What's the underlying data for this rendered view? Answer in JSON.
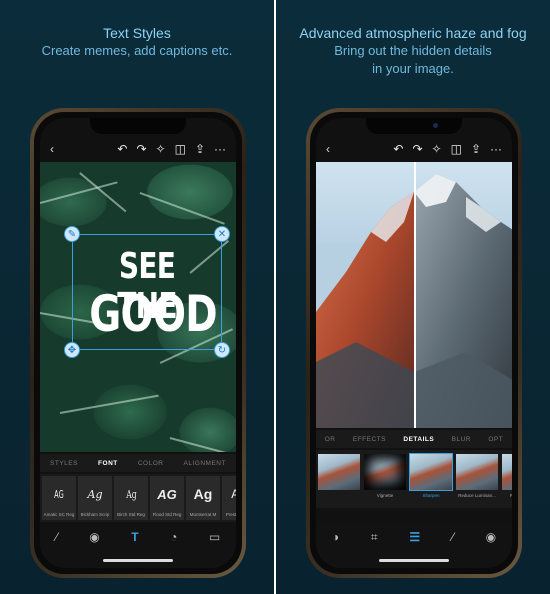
{
  "panels": [
    {
      "caption_title": "Text Styles",
      "caption_lines": [
        "Create memes, add captions etc."
      ]
    },
    {
      "caption_title": "Advanced atmospheric haze and fog",
      "caption_lines": [
        "Bring out the hidden details",
        "in your image."
      ]
    }
  ],
  "left_phone": {
    "topbar": {
      "back": "‹",
      "undo": "↶",
      "redo": "↷",
      "magic": "✧",
      "compare": "◫",
      "share": "⇪",
      "more": "···"
    },
    "overlay_text": [
      "SEE THE",
      "GOOD"
    ],
    "handles": {
      "tl": "✎",
      "tr": "✕",
      "bl": "✥",
      "br": "↻"
    },
    "tabs": [
      {
        "label": "STYLES",
        "active": false
      },
      {
        "label": "FONT",
        "active": true
      },
      {
        "label": "COLOR",
        "active": false
      },
      {
        "label": "ALIGNMENT",
        "active": false
      }
    ],
    "fonts": [
      {
        "glyph": "AG",
        "label": "Amatic SC Reg"
      },
      {
        "glyph": "Ag",
        "label": "Bickham Scrip"
      },
      {
        "glyph": "Ag",
        "label": "Birch Std Reg"
      },
      {
        "glyph": "AG",
        "label": "Flood Std Reg"
      },
      {
        "glyph": "Ag",
        "label": "Montserrat M"
      },
      {
        "glyph": "Ag",
        "label": "Prestige Elite"
      }
    ],
    "bottom_icons": [
      "bandage",
      "eye",
      "T",
      "sticker",
      "frame"
    ]
  },
  "right_phone": {
    "topbar": {
      "back": "‹",
      "undo": "↶",
      "redo": "↷",
      "magic": "✧",
      "compare": "◫",
      "share": "⇪",
      "more": "···"
    },
    "tabs": [
      {
        "label": "OR",
        "active": false
      },
      {
        "label": "EFFECTS",
        "active": false
      },
      {
        "label": "DETAILS",
        "active": true
      },
      {
        "label": "BLUR",
        "active": false
      },
      {
        "label": "OPT",
        "active": false
      }
    ],
    "effects": [
      {
        "label": "",
        "selected": false
      },
      {
        "label": "Vignette",
        "selected": false
      },
      {
        "label": "Sharpen",
        "selected": true
      },
      {
        "label": "Reduce Luminan...",
        "selected": false
      },
      {
        "label": "Reduce Colo",
        "selected": false
      }
    ],
    "bottom_icons": [
      "looks",
      "crop",
      "adjust",
      "bandage",
      "eye"
    ]
  },
  "colors": {
    "accent": "#3aa0e0",
    "caption": "#8ed3f4",
    "panel_bg": "#0b2c3a"
  }
}
